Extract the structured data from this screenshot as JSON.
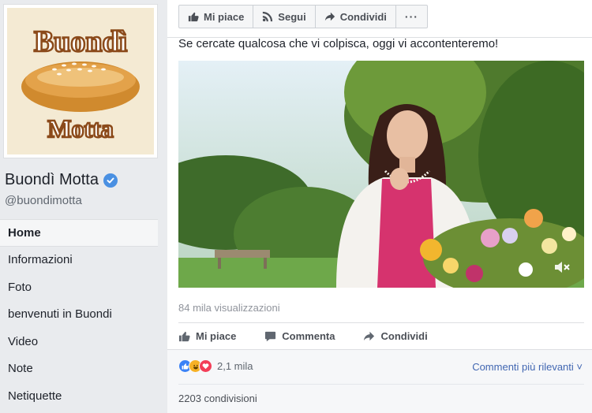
{
  "page": {
    "name": "Buondì Motta",
    "handle": "@buondimotta",
    "logo_text_top": "Buondì",
    "logo_text_bottom": "Motta"
  },
  "nav": {
    "items": [
      {
        "label": "Home",
        "active": true
      },
      {
        "label": "Informazioni"
      },
      {
        "label": "Foto"
      },
      {
        "label": "benvenuti in Buondi"
      },
      {
        "label": "Video"
      },
      {
        "label": "Note"
      },
      {
        "label": "Netiquette"
      }
    ]
  },
  "actionbar": {
    "like": "Mi piace",
    "follow": "Segui",
    "share": "Condividi",
    "more": "···"
  },
  "post": {
    "text": "Se cercate qualcosa che vi colpisca, oggi vi accontenteremo!",
    "views": "84 mila visualizzazioni",
    "actions": {
      "like": "Mi piace",
      "comment": "Commenta",
      "share": "Condividi"
    },
    "reaction_count": "2,1 mila",
    "relevance": "Commenti più rilevanti ˅",
    "shares": "2203 condivisioni"
  },
  "colors": {
    "facebook_blue": "#4267b2",
    "like_blue": "#3b82f6",
    "love_red": "#f33e58",
    "haha_yellow": "#f7b125"
  }
}
